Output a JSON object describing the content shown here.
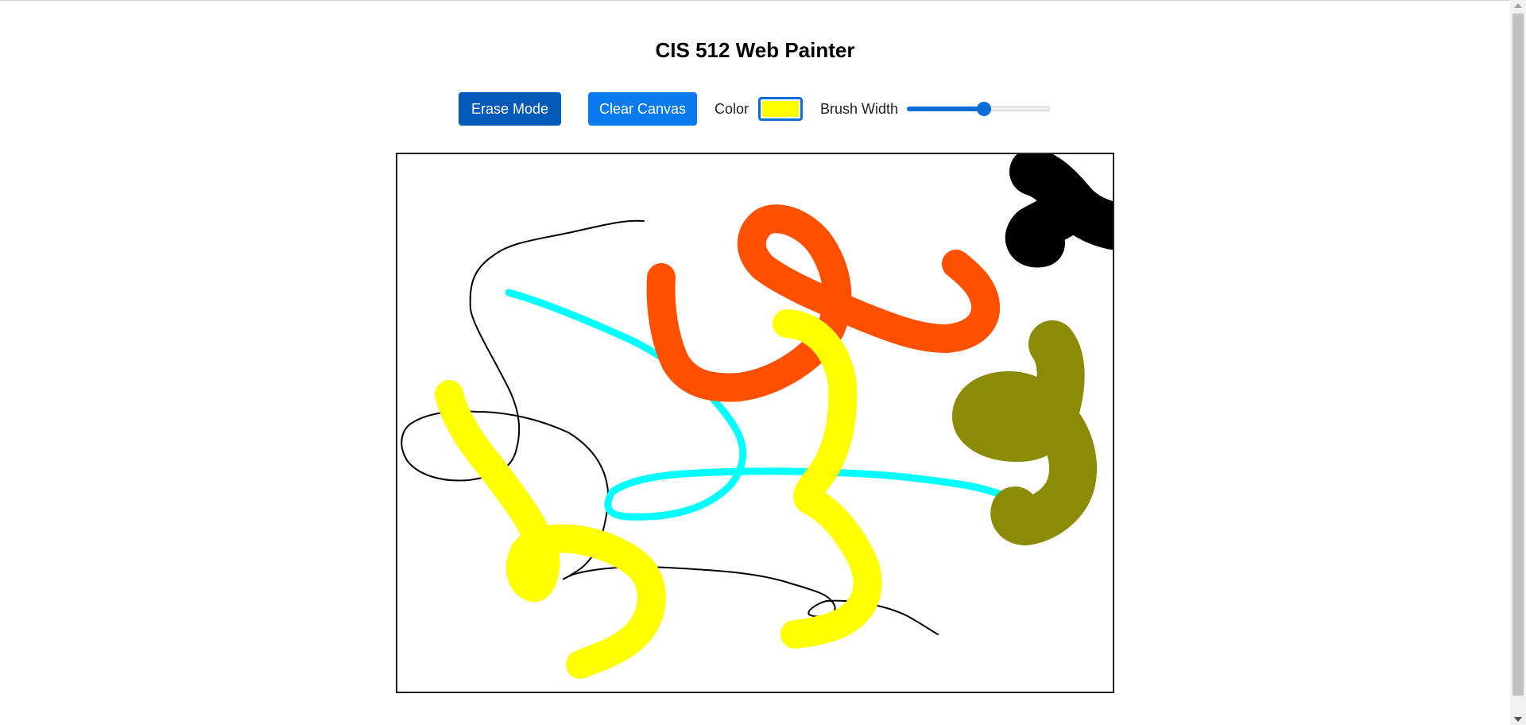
{
  "page": {
    "title": "CIS 512 Web Painter"
  },
  "toolbar": {
    "erase_label": "Erase Mode",
    "clear_label": "Clear Canvas",
    "color_label": "Color",
    "color_value": "#ffff00",
    "brush_width_label": "Brush Width",
    "brush_width_fraction": 0.54
  },
  "canvas": {
    "strokes": [
      {
        "color": "#000000",
        "width": 2
      },
      {
        "color": "#00ffff",
        "width": 9
      },
      {
        "color": "#ff5000",
        "width": 36
      },
      {
        "color": "#ffff00",
        "width": 36
      },
      {
        "color": "#8b8b08",
        "width": 60
      },
      {
        "color": "#000000",
        "width": 60
      }
    ]
  }
}
